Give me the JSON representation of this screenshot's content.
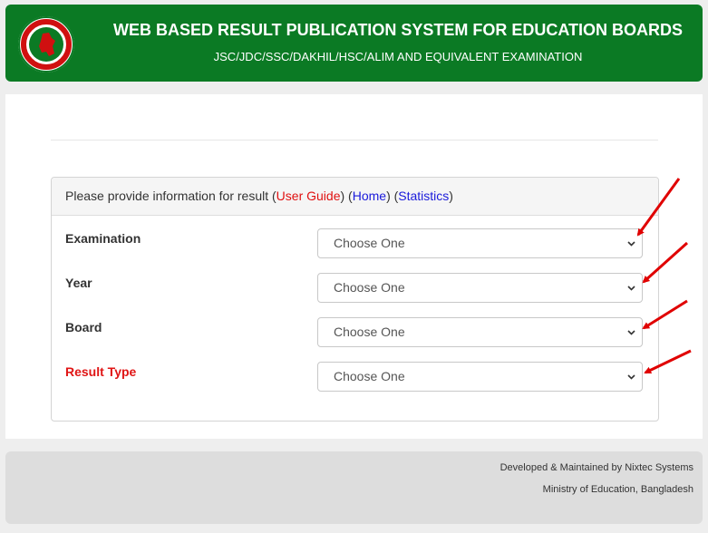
{
  "header": {
    "title": "WEB BASED RESULT PUBLICATION SYSTEM FOR EDUCATION BOARDS",
    "subtitle": "JSC/JDC/SSC/DAKHIL/HSC/ALIM AND EQUIVALENT EXAMINATION",
    "logo_icon": "bangladesh-government-seal",
    "bg_color": "#0b7a24"
  },
  "panel": {
    "prompt": "Please provide information for result",
    "user_guide": "User Guide",
    "home": "Home",
    "statistics": "Statistics"
  },
  "form": {
    "fields": [
      {
        "label": "Examination",
        "value": "Choose One"
      },
      {
        "label": "Year",
        "value": "Choose One"
      },
      {
        "label": "Board",
        "value": "Choose One"
      },
      {
        "label": "Result Type",
        "value": "Choose One"
      }
    ]
  },
  "footer": {
    "developed": "Developed & Maintained by Nixtec Systems",
    "ministry": "Ministry of Education, Bangladesh"
  },
  "annotation_color": "#e00000"
}
